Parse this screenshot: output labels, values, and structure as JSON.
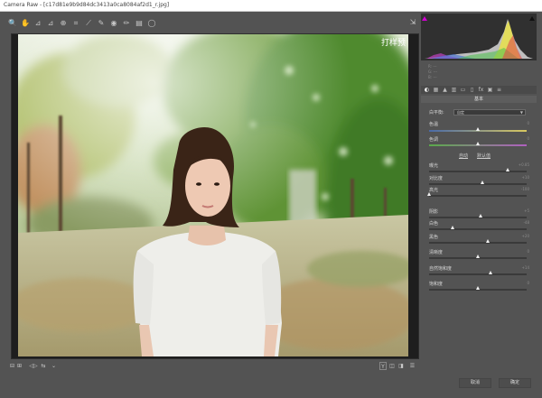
{
  "window": {
    "title": "Camera Raw - [c17d81e9b9d84dc3413a0ca8084af2d1_r.jpg]"
  },
  "toolbar": {
    "tools": [
      {
        "name": "zoom-tool-icon",
        "glyph": "🔍"
      },
      {
        "name": "hand-tool-icon",
        "glyph": "✋"
      },
      {
        "name": "white-balance-tool-icon",
        "glyph": "⊿"
      },
      {
        "name": "color-sampler-tool-icon",
        "glyph": "⊿"
      },
      {
        "name": "targeted-adjustment-tool-icon",
        "glyph": "⊕"
      },
      {
        "name": "crop-tool-icon",
        "glyph": "⌗"
      },
      {
        "name": "straighten-tool-icon",
        "glyph": "⟋"
      },
      {
        "name": "spot-removal-tool-icon",
        "glyph": "✎"
      },
      {
        "name": "red-eye-tool-icon",
        "glyph": "◉"
      },
      {
        "name": "adjustment-brush-icon",
        "glyph": "✏"
      },
      {
        "name": "graduated-filter-icon",
        "glyph": "▤"
      },
      {
        "name": "radial-filter-icon",
        "glyph": "◯"
      }
    ],
    "fullscreen_glyph": "⇲"
  },
  "image": {
    "watermark": "打样预"
  },
  "histogram": {
    "clip_shadow_color": "#d000d0",
    "clip_highlight_color": "#111111",
    "readouts": [
      "R: ---",
      "G: ---",
      "B: ---"
    ]
  },
  "panel_tabs": [
    {
      "name": "basic-tab-icon",
      "glyph": "◐"
    },
    {
      "name": "tone-curve-tab-icon",
      "glyph": "▦"
    },
    {
      "name": "detail-tab-icon",
      "glyph": "▲"
    },
    {
      "name": "hsl-tab-icon",
      "glyph": "▥"
    },
    {
      "name": "split-toning-tab-icon",
      "glyph": "▭"
    },
    {
      "name": "lens-corrections-tab-icon",
      "glyph": "▯"
    },
    {
      "name": "effects-tab-icon",
      "glyph": "fx"
    },
    {
      "name": "camera-calibration-tab-icon",
      "glyph": "▣"
    },
    {
      "name": "presets-tab-icon",
      "glyph": "≡"
    }
  ],
  "basic": {
    "section_title": "基本",
    "white_balance_label": "白平衡:",
    "white_balance_value": "自定",
    "temperature_label": "色温",
    "temperature_value": "0",
    "tint_label": "色调",
    "tint_value": "0",
    "auto_label": "自动",
    "default_label": "默认值",
    "sliders": [
      {
        "key": "exposure",
        "label": "曝光",
        "value": "+0.85",
        "pos": 0.81
      },
      {
        "key": "contrast",
        "label": "对比度",
        "value": "+10",
        "pos": 0.55
      },
      {
        "key": "highlights",
        "label": "高光",
        "value": "-100",
        "pos": 0.0
      },
      {
        "key": "shadows",
        "label": "阴影",
        "value": "+5",
        "pos": 0.53
      },
      {
        "key": "whites",
        "label": "白色",
        "value": "-48",
        "pos": 0.24
      },
      {
        "key": "blacks",
        "label": "黑色",
        "value": "+20",
        "pos": 0.6
      },
      {
        "key": "clarity",
        "label": "清晰度",
        "value": "0",
        "pos": 0.5
      },
      {
        "key": "vibrance",
        "label": "自然饱和度",
        "value": "+14",
        "pos": 0.63
      },
      {
        "key": "saturation",
        "label": "饱和度",
        "value": "0",
        "pos": 0.5
      }
    ],
    "temperature_pos": 0.5,
    "tint_pos": 0.5
  },
  "footer": {
    "cancel_label": "取消",
    "done_label": "确定"
  },
  "bottombar": {
    "zoom_icons": [
      "⊟",
      "⊞"
    ],
    "nav_icons": [
      "◁▷",
      "⇆"
    ],
    "view_icons": [
      "Y",
      "◫",
      "◨",
      "☰"
    ]
  }
}
